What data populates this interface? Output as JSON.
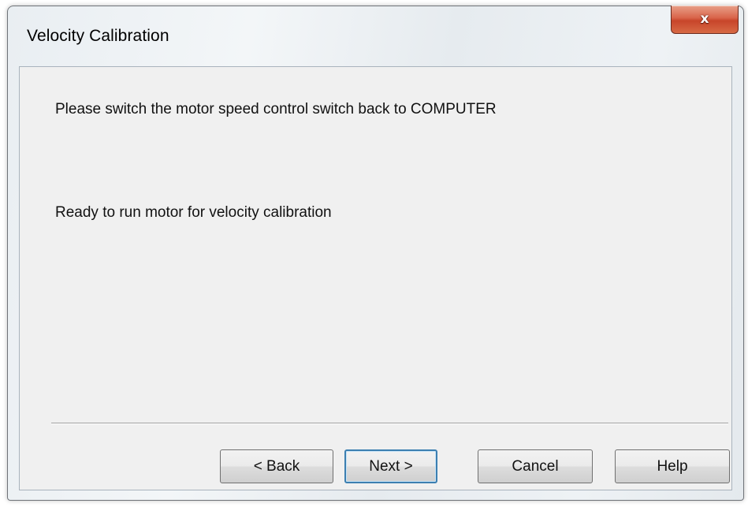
{
  "window": {
    "title": "Velocity Calibration",
    "close_symbol": "x"
  },
  "content": {
    "instruction": "Please switch the motor speed control switch back to COMPUTER",
    "status": "Ready to run motor for velocity calibration"
  },
  "buttons": {
    "back": "< Back",
    "next": "Next >",
    "cancel": "Cancel",
    "help": "Help"
  },
  "icons": {
    "close": "close-icon"
  },
  "colors": {
    "close_button": "#c8452a",
    "dialog_background": "#f0f0f0",
    "default_button_border": "#3c7fb1"
  }
}
